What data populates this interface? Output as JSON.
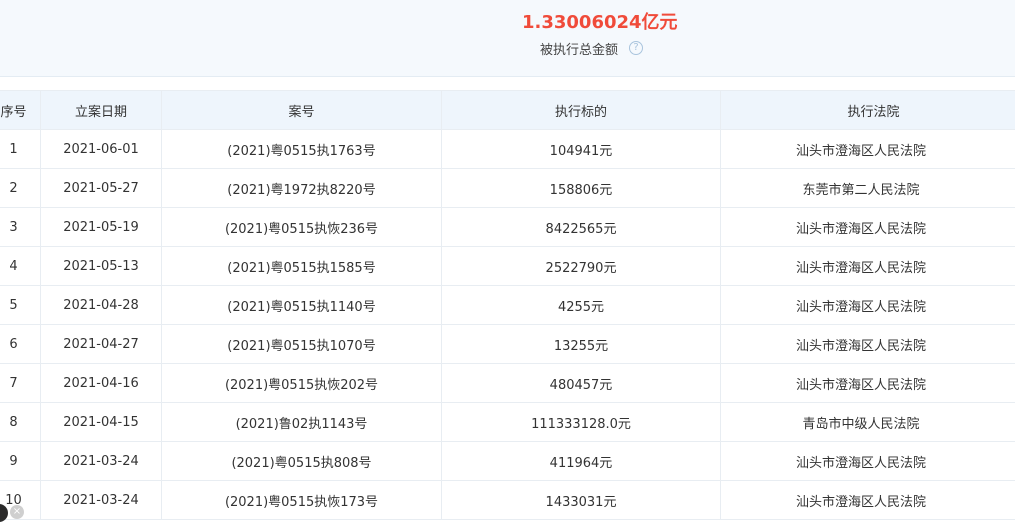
{
  "summary": {
    "total_amount": "1.33006024亿元",
    "total_label": "被执行总金额",
    "help_icon": "question-circle-icon"
  },
  "table": {
    "headers": [
      "序号",
      "立案日期",
      "案号",
      "执行标的",
      "执行法院"
    ],
    "rows": [
      [
        "1",
        "2021-06-01",
        "(2021)粤0515执1763号",
        "104941元",
        "汕头市澄海区人民法院"
      ],
      [
        "2",
        "2021-05-27",
        "(2021)粤1972执8220号",
        "158806元",
        "东莞市第二人民法院"
      ],
      [
        "3",
        "2021-05-19",
        "(2021)粤0515执恢236号",
        "8422565元",
        "汕头市澄海区人民法院"
      ],
      [
        "4",
        "2021-05-13",
        "(2021)粤0515执1585号",
        "2522790元",
        "汕头市澄海区人民法院"
      ],
      [
        "5",
        "2021-04-28",
        "(2021)粤0515执1140号",
        "4255元",
        "汕头市澄海区人民法院"
      ],
      [
        "6",
        "2021-04-27",
        "(2021)粤0515执1070号",
        "13255元",
        "汕头市澄海区人民法院"
      ],
      [
        "7",
        "2021-04-16",
        "(2021)粤0515执恢202号",
        "480457元",
        "汕头市澄海区人民法院"
      ],
      [
        "8",
        "2021-04-15",
        "(2021)鲁02执1143号",
        "111333128.0元",
        "青岛市中级人民法院"
      ],
      [
        "9",
        "2021-03-24",
        "(2021)粤0515执808号",
        "411964元",
        "汕头市澄海区人民法院"
      ],
      [
        "10",
        "2021-03-24",
        "(2021)粤0515执恢173号",
        "1433031元",
        "汕头市澄海区人民法院"
      ]
    ]
  },
  "floating": {
    "close_icon": "close-icon",
    "close_glyph": "×"
  },
  "colors": {
    "amount_red": "#f04b3a",
    "header_bg": "#eef5fc",
    "summary_bg": "#f5f9fd",
    "border": "#e8edf2"
  }
}
